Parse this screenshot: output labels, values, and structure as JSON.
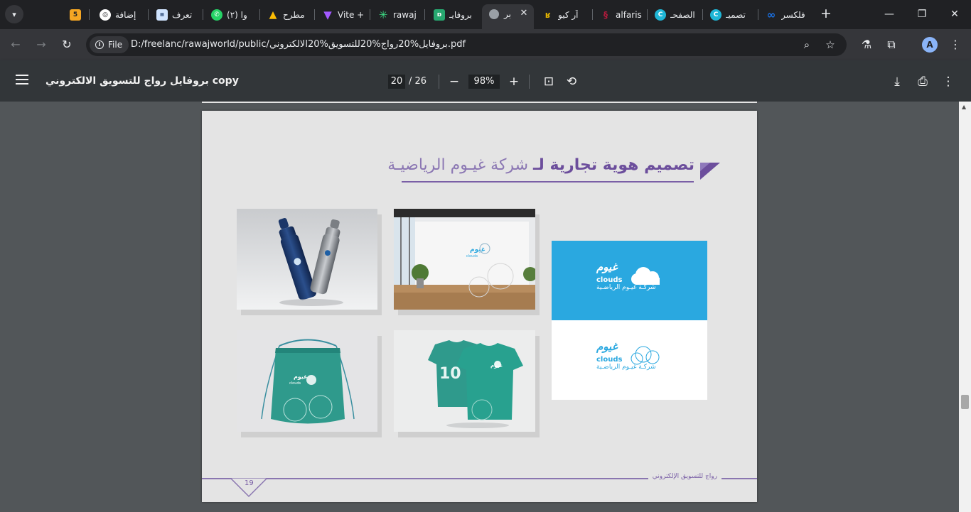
{
  "tabs": [
    {
      "label": "فلكسر",
      "icon": "infinity-icon",
      "color": "#1a73e8"
    },
    {
      "label": "تصميـ",
      "icon": "canva-icon",
      "color": "#1fb6d6"
    },
    {
      "label": "الصفحـ",
      "icon": "canva-icon",
      "color": "#1fb6d6"
    },
    {
      "label": "alfaris",
      "icon": "alfaris-icon",
      "color": "#b31b3c"
    },
    {
      "label": "آر كيو",
      "icon": "rq-icon",
      "color": "#e3b400"
    },
    {
      "label": "بر",
      "icon": "globe-icon",
      "color": "#9aa0a6",
      "active": true
    },
    {
      "label": "بروفايـ",
      "icon": "doc-icon",
      "color": "#27a870"
    },
    {
      "label": "rawaj",
      "icon": "spark-icon",
      "color": "#3ddc84"
    },
    {
      "label": "Vite +",
      "icon": "vite-icon",
      "color": "#a259ff"
    },
    {
      "label": "مطرح",
      "icon": "drive-icon",
      "color": "#34a853"
    },
    {
      "label": "(٢) وا",
      "icon": "whatsapp-icon",
      "color": "#25d366"
    },
    {
      "label": "تعرف",
      "icon": "site-icon",
      "color": "#d0e4ff"
    },
    {
      "label": "إضافة",
      "icon": "chatgpt-icon",
      "color": "#ffffff"
    },
    {
      "label": "",
      "icon": "five-icon",
      "color": "#f5a623"
    }
  ],
  "five_badge": "5",
  "address": {
    "chip": "File",
    "url": "D:/freelanc/rawajworld/public/بروفايل%20رواج%20للتسويق%20الالكتروني.pdf"
  },
  "profile_initial": "A",
  "pdf": {
    "title": "بروفايل رواج للتسويق الالكتروني copy",
    "page_current": "20",
    "page_total": "/ 26",
    "zoom": "98%"
  },
  "page": {
    "heading_strong": "تصميم هوية تجارية لـ",
    "heading_light": "شركة غيـوم الرياضيـة",
    "logo_arabic": "غيوم",
    "logo_latin": "clouds",
    "logo_tagline": "شركـة غيـوم الرياضـية",
    "page_number": "19",
    "footer_text": "رواج للتسويق الإلكتروني",
    "jersey_number": "10"
  }
}
